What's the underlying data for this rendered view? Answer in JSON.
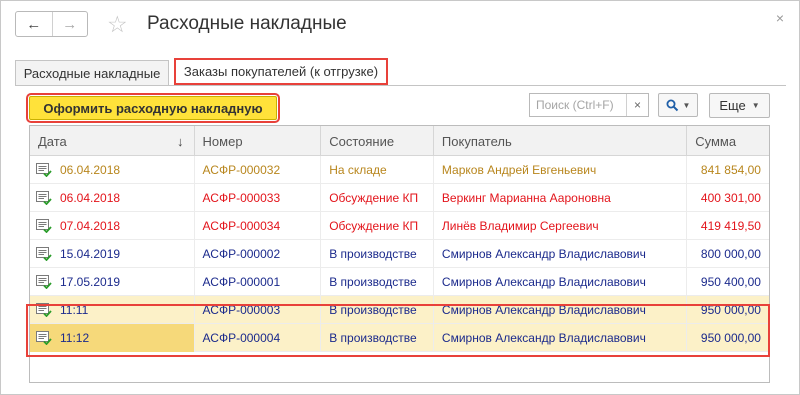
{
  "window": {
    "title": "Расходные накладные",
    "back_icon": "←",
    "forward_icon": "→",
    "favorite_icon": "☆",
    "close_icon": "×"
  },
  "tabs": [
    {
      "label": "Расходные накладные"
    },
    {
      "label": "Заказы покупателей (к отгрузке)"
    }
  ],
  "toolbar": {
    "main_action_label": "Оформить расходную накладную",
    "search_placeholder": "Поиск (Ctrl+F)",
    "search_clear": "×",
    "more_label": "Еще"
  },
  "table": {
    "headers": [
      "Дата",
      "Номер",
      "Состояние",
      "Покупатель",
      "Сумма"
    ],
    "sort_indicator": "↓",
    "rows": [
      {
        "date": "06.04.2018",
        "number": "АСФР-000032",
        "status": "На складе",
        "customer": "Марков Андрей Евгеньевич",
        "sum": "841 854,00",
        "color": "#b8861d"
      },
      {
        "date": "06.04.2018",
        "number": "АСФР-000033",
        "status": "Обсуждение КП",
        "customer": "Веркинг Марианна Аароновна",
        "sum": "400 301,00",
        "color": "#e3141b"
      },
      {
        "date": "07.04.2018",
        "number": "АСФР-000034",
        "status": "Обсуждение КП",
        "customer": "Линёв Владимир Сергеевич",
        "sum": "419 419,50",
        "color": "#e3141b"
      },
      {
        "date": "15.04.2019",
        "number": "АСФР-000002",
        "status": "В производстве",
        "customer": "Смирнов Александр Владиславович",
        "sum": "800 000,00",
        "color": "#1b2a8c"
      },
      {
        "date": "17.05.2019",
        "number": "АСФР-000001",
        "status": "В производстве",
        "customer": "Смирнов Александр Владиславович",
        "sum": "950 400,00",
        "color": "#1b2a8c"
      },
      {
        "date": "11:11",
        "number": "АСФР-000003",
        "status": "В производстве",
        "customer": "Смирнов Александр Владиславович",
        "sum": "950 000,00",
        "color": "#1b2a8c"
      },
      {
        "date": "11:12",
        "number": "АСФР-000004",
        "status": "В производстве",
        "customer": "Смирнов Александр Владиславович",
        "sum": "950 000,00",
        "color": "#1b2a8c"
      }
    ]
  },
  "colors": {
    "accent_yellow": "#ffe23a",
    "highlight_red": "#e8413a",
    "row_highlight": "#fcf1c8"
  }
}
